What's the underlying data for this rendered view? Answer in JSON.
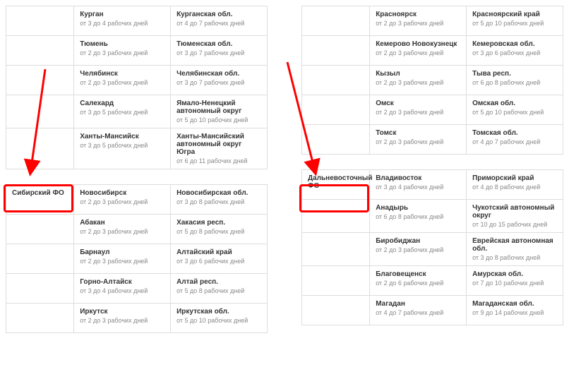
{
  "left": {
    "top_rows": [
      {
        "head": "",
        "city": "Курган",
        "cterm": "от 3 до 4 рабочих дней",
        "area": "Курганская обл.",
        "aterm": "от 4 до 7 рабочих дней"
      },
      {
        "head": "",
        "city": "Тюмень",
        "cterm": "от 2 до 3 рабочих дней",
        "area": "Тюменская обл.",
        "aterm": "от 3 до 7 рабочих дней"
      },
      {
        "head": "",
        "city": "Челябинск",
        "cterm": "от 2 до 3 рабочих дней",
        "area": "Челябинская обл.",
        "aterm": "от 3 до 7 рабочих дней"
      },
      {
        "head": "",
        "city": "Салехард",
        "cterm": "от 3 до 5 рабочих дней",
        "area": "Ямало-Ненецкий автономный округ",
        "aterm": "от 5 до 10 рабочих дней"
      },
      {
        "head": "",
        "city": "Ханты-Мансийск",
        "cterm": "от 3 до 5 рабочих дней",
        "area": "Ханты-Мансийский автономный округ Югра",
        "aterm": "от 6 до 11 рабочих дней"
      }
    ],
    "header_row": {
      "head": "Сибирский ФО",
      "city": "Новосибирск",
      "cterm": "от 2 до 3 рабочих дней",
      "area": "Новосибирская обл.",
      "aterm": "от 3 до 8 рабочих дней"
    },
    "bottom_rows": [
      {
        "head": "",
        "city": "Абакан",
        "cterm": "от 2 до 3 рабочих дней",
        "area": "Хакасия респ.",
        "aterm": "от 5 до 8 рабочих дней"
      },
      {
        "head": "",
        "city": "Барнаул",
        "cterm": "от 2 до 3 рабочих дней",
        "area": "Алтайский край",
        "aterm": "от 3 до 6 рабочих дней"
      },
      {
        "head": "",
        "city": "Горно-Алтайск",
        "cterm": "от 3 до 4 рабочих дней",
        "area": "Алтай респ.",
        "aterm": "от 5 до 8 рабочих дней"
      },
      {
        "head": "",
        "city": "Иркутск",
        "cterm": "от 2 до 3 рабочих дней",
        "area": "Иркутская обл.",
        "aterm": "от 5 до 10 рабочих дней"
      }
    ]
  },
  "right": {
    "top_rows": [
      {
        "head": "",
        "city": "Красноярск",
        "cterm": "от 2 до 3 рабочих дней",
        "area": "Красноярский край",
        "aterm": "от 5 до 10 рабочих дней"
      },
      {
        "head": "",
        "city": "Кемерово Новокузнецк",
        "cterm": "от 2 до 3 рабочих дней",
        "area": "Кемеровская обл.",
        "aterm": "от 3 до 6 рабочих дней"
      },
      {
        "head": "",
        "city": "Кызыл",
        "cterm": "от 2 до 3 рабочих дней",
        "area": "Тыва респ.",
        "aterm": "от 6 до 8 рабочих дней"
      },
      {
        "head": "",
        "city": "Омск",
        "cterm": "от 2 до 3 рабочих дней",
        "area": "Омская обл.",
        "aterm": "от 5 до 10 рабочих дней"
      },
      {
        "head": "",
        "city": "Томск",
        "cterm": "от 2 до 3 рабочих дней",
        "area": "Томская обл.",
        "aterm": "от 4 до 7 рабочих дней"
      }
    ],
    "header_row": {
      "head": "Дальневосточный ФО",
      "city": "Владивосток",
      "cterm": "от 3 до 4 рабочих дней",
      "area": "Приморский край",
      "aterm": "от 4 до 8 рабочих дней"
    },
    "bottom_rows": [
      {
        "head": "",
        "city": "Анадырь",
        "cterm": "от 6 до 8 рабочих дней",
        "area": "Чукотский автономный округ",
        "aterm": "от 10 до 15 рабочих дней"
      },
      {
        "head": "",
        "city": "Биробиджан",
        "cterm": "от 2 до 3 рабочих дней",
        "area": "Еврейская автономная обл.",
        "aterm": "от 3 до 8 рабочих дней"
      },
      {
        "head": "",
        "city": "Благовещенск",
        "cterm": "от 2 до 6 рабочих дней",
        "area": "Амурская обл.",
        "aterm": "от 7 до 10 рабочих дней"
      },
      {
        "head": "",
        "city": "Магадан",
        "cterm": "от 4 до 7 рабочих дней",
        "area": "Магаданская обл.",
        "aterm": "от 9 до 14 рабочих дней"
      }
    ]
  }
}
